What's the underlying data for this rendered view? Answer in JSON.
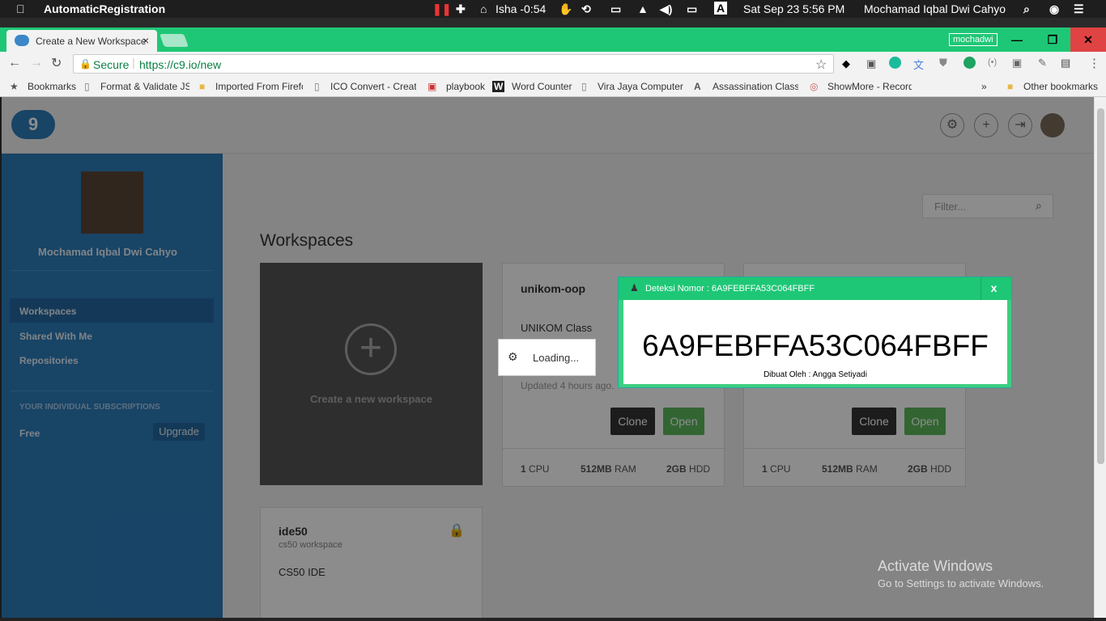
{
  "menubar": {
    "app_name": "AutomaticRegistration",
    "prayer": "Isha -0:54",
    "date_time": "Sat Sep 23  5:56 PM",
    "user": "Mochamad Iqbal Dwi Cahyo",
    "input_source": "A"
  },
  "browser": {
    "tab_title": "Create a New Workspace",
    "profile": "mochadwi",
    "secure_label": "Secure",
    "url": "https://c9.io/new",
    "bookmarks": [
      "Bookmarks",
      "Format & Validate JS",
      "Imported From Firefo",
      "ICO Convert - Create",
      "playbook",
      "Word Counter",
      "Vira Jaya Computer (",
      "Assassination Classro",
      "ShowMore - Record,"
    ],
    "other_bookmarks": "Other bookmarks",
    "more": "»"
  },
  "c9": {
    "logo": "9",
    "profile_name": "Mochamad Iqbal Dwi Cahyo",
    "nav": [
      "Workspaces",
      "Shared With Me",
      "Repositories"
    ],
    "subscriptions_title": "YOUR INDIVIDUAL SUBSCRIPTIONS",
    "plan": "Free",
    "upgrade": "Upgrade",
    "filter_placeholder": "Filter...",
    "heading": "Workspaces",
    "create_label": "Create a new workspace",
    "workspaces": [
      {
        "name": "unikom-oop",
        "desc": "UNIKOM Class",
        "updated": "Updated 4 hours ago.",
        "cpu": "1",
        "ram": "512MB",
        "hdd": "2GB"
      },
      {
        "name": "",
        "desc": "",
        "updated": "",
        "cpu": "1",
        "ram": "512MB",
        "hdd": "2GB"
      },
      {
        "name": "ide50",
        "subtitle": "cs50 workspace",
        "desc": "CS50 IDE"
      }
    ],
    "clone": "Clone",
    "open": "Open",
    "cpu_unit": "CPU",
    "ram_unit": "RAM",
    "hdd_unit": "HDD"
  },
  "loading": "Loading...",
  "popup": {
    "title": "Deteksi Nomor : 6A9FEBFFA53C064FBFF",
    "code": "6A9FEBFFA53C064FBFF",
    "footer": "Dibuat Oleh : Angga Setiyadi",
    "close": "x"
  },
  "watermark": {
    "title": "Activate Windows",
    "sub": "Go to Settings to activate Windows."
  }
}
